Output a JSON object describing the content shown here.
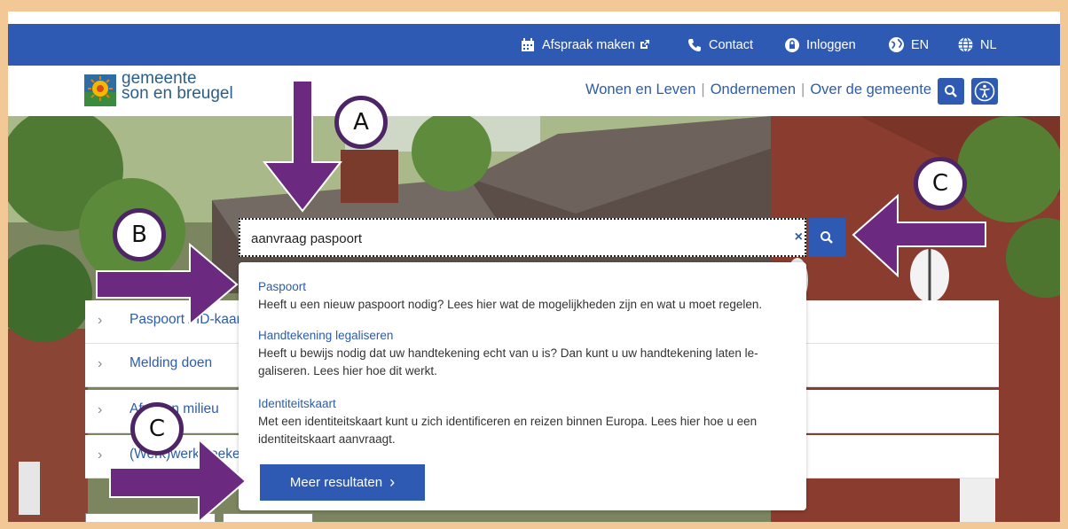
{
  "topbar": {
    "appointment": "Afspraak maken",
    "contact": "Contact",
    "login": "Inloggen",
    "lang_en": "EN",
    "lang_nl": "NL"
  },
  "header": {
    "logo_line1": "gemeente",
    "logo_line2": "son en breugel",
    "nav": [
      "Wonen en Leven",
      "Ondernemen",
      "Over de gemeente"
    ]
  },
  "list_items": [
    "Paspoort / ID-kaart",
    "Melding doen",
    "Afval en milieu",
    "(Werk)werk zoeken"
  ],
  "search": {
    "value": "aanvraag paspoort",
    "clear": "×"
  },
  "suggestions": [
    {
      "title": "Paspoort",
      "desc": "Heeft u een nieuw paspoort nodig? Lees hier wat de mogelijkheden zijn en wat u moet regelen."
    },
    {
      "title": "Handtekening legaliseren",
      "desc": "Heeft u bewijs nodig dat uw handtekening echt van u is? Dan kunt u uw handtekening laten le-galiseren. Lees hier hoe dit werkt."
    },
    {
      "title": "Identiteitskaart",
      "desc": "Met een identiteitskaart kunt u zich identificeren en reizen binnen Europa. Lees hier hoe u een identiteitskaart aanvraagt."
    }
  ],
  "more_results": "Meer resultaten",
  "more_results_chevron": "›",
  "callouts": {
    "a": "A",
    "b": "B",
    "c1": "C",
    "c2": "C"
  },
  "colors": {
    "brand_blue": "#2f5ab3",
    "link_blue": "#2d5caa",
    "arrow_purple": "#6b2a80",
    "frame": "#f2c896"
  }
}
